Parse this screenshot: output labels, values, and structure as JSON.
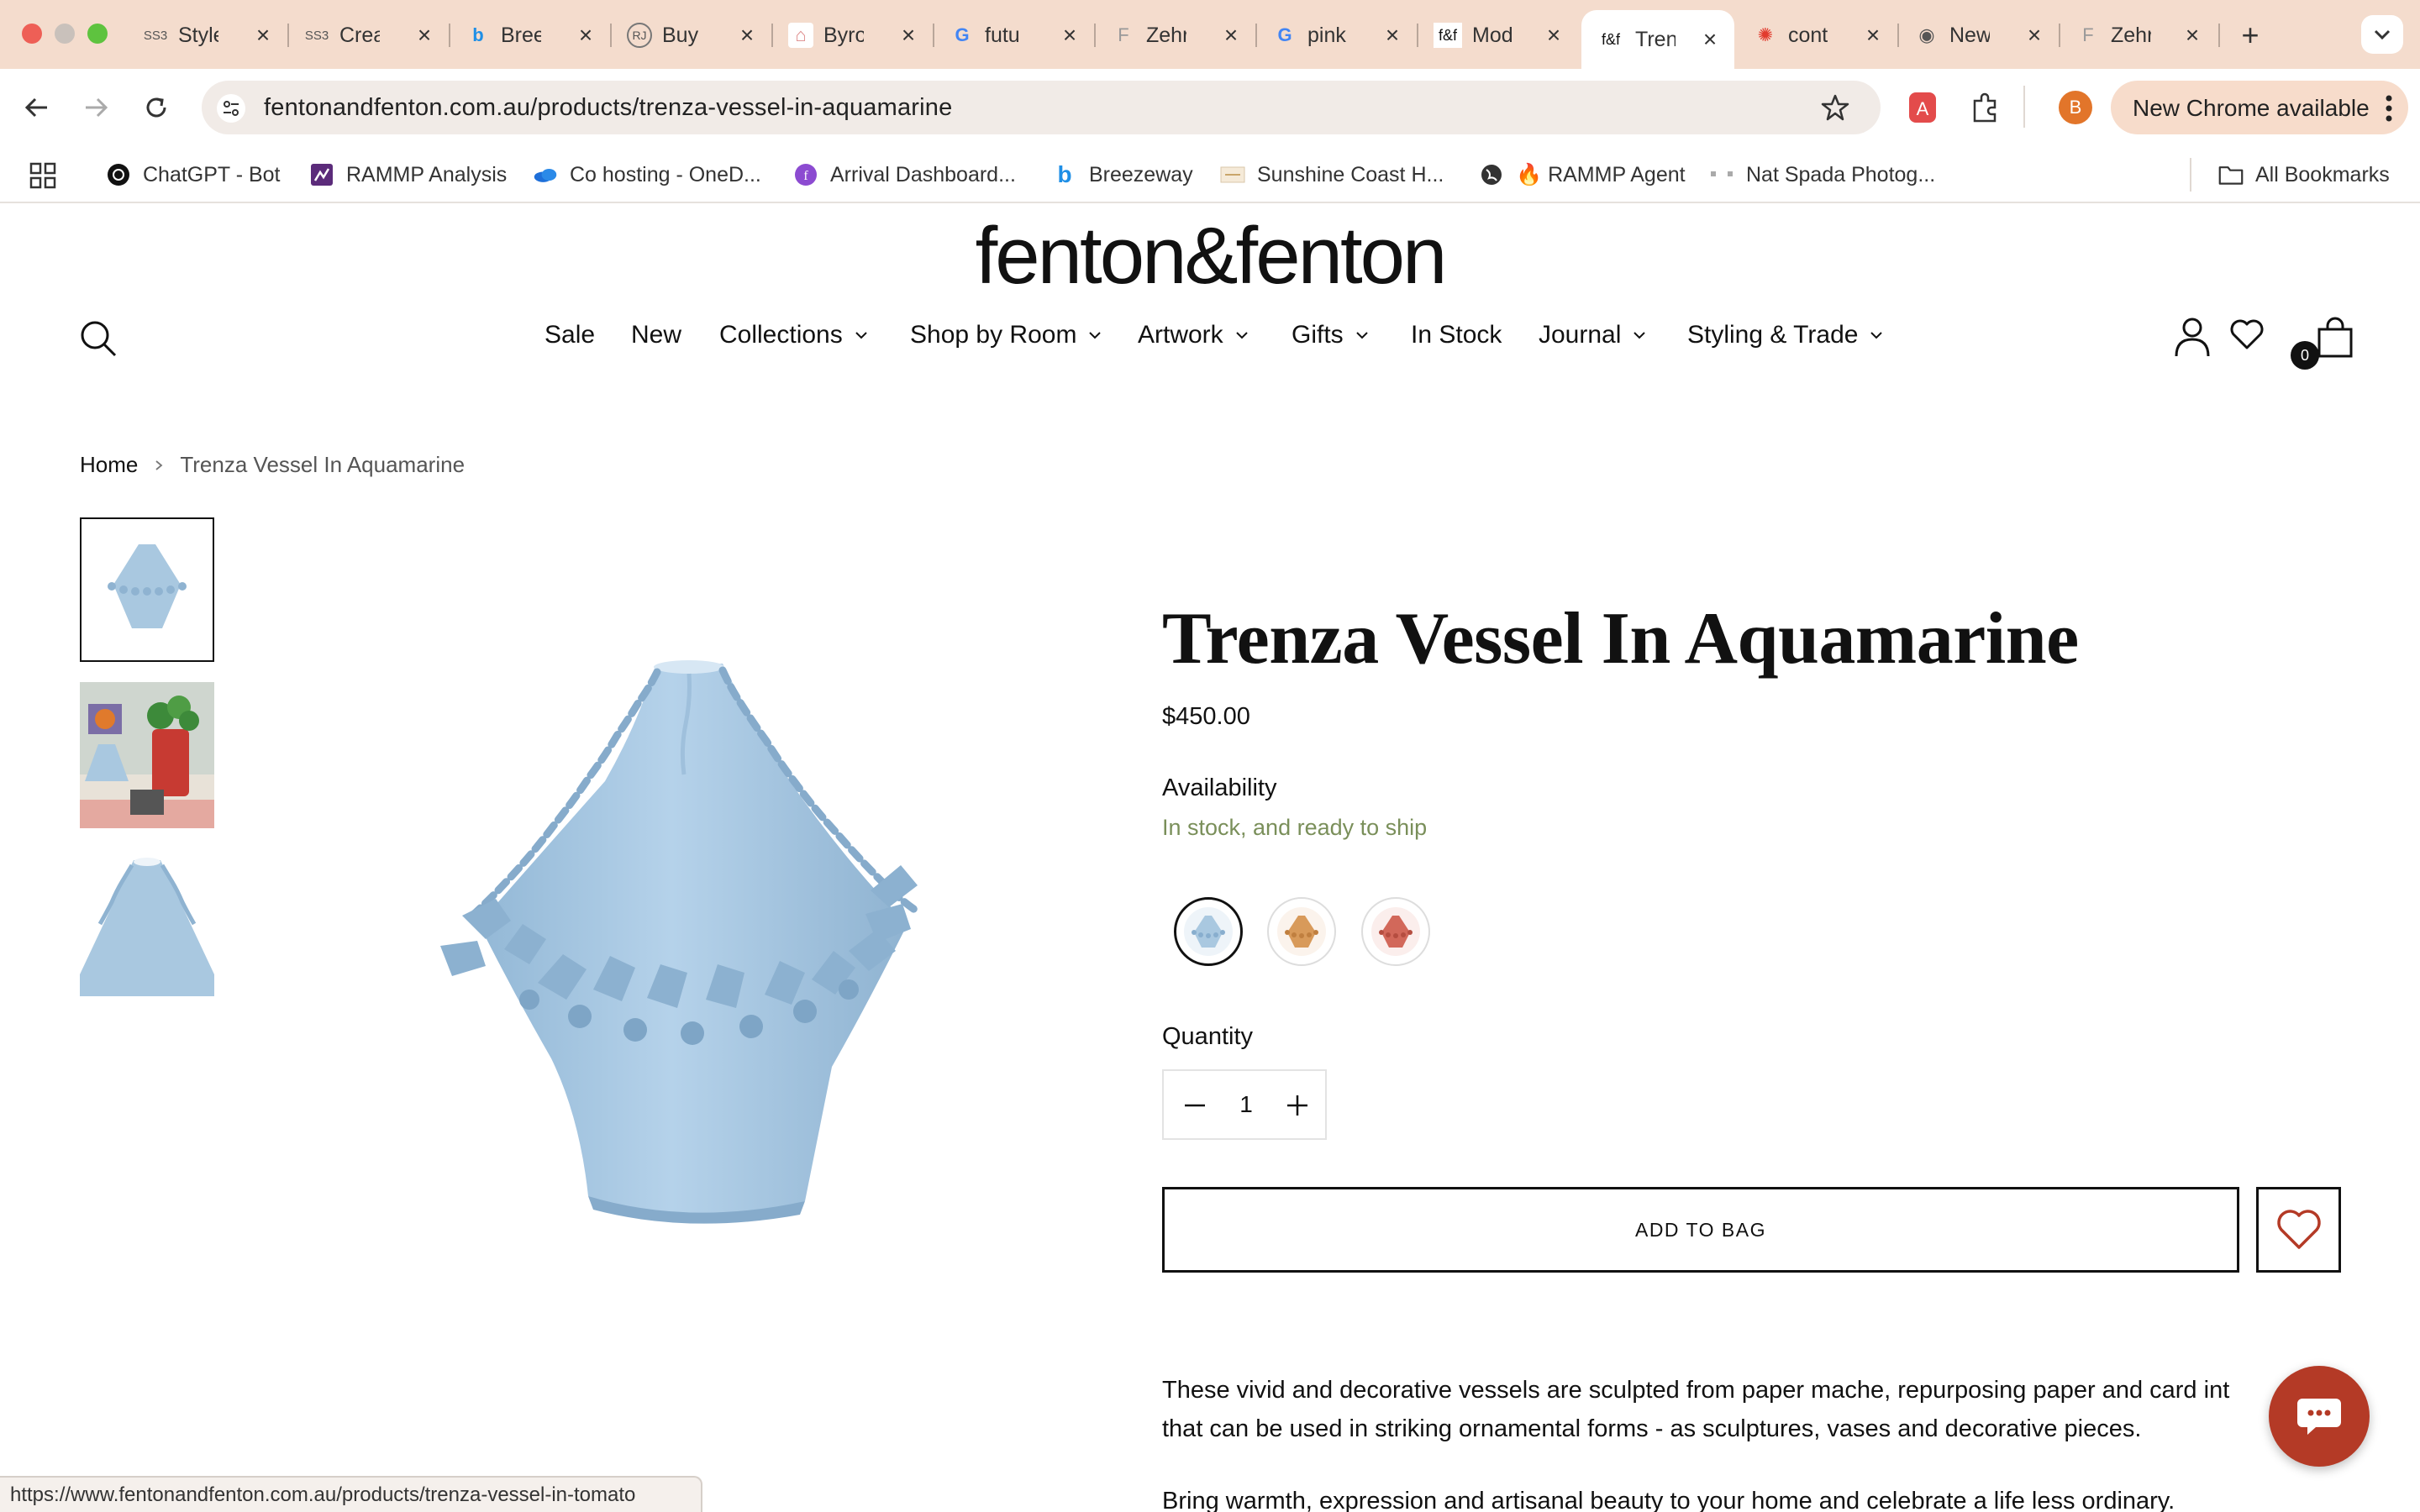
{
  "tabs": [
    {
      "icon": "SS3",
      "title": "Style"
    },
    {
      "icon": "SS3",
      "title": "Crea"
    },
    {
      "icon": "b",
      "title": "Bree"
    },
    {
      "icon": "RJ",
      "title": "Buy"
    },
    {
      "icon": "⌂",
      "title": "Byro"
    },
    {
      "icon": "G",
      "title": "futu"
    },
    {
      "icon": "F",
      "title": "Zehr"
    },
    {
      "icon": "G",
      "title": "pink"
    },
    {
      "icon": "f&f",
      "title": "Mod"
    },
    {
      "icon": "f&f",
      "title": "Tren",
      "active": true
    },
    {
      "icon": "✺",
      "title": "cont"
    },
    {
      "icon": "◉",
      "title": "New"
    },
    {
      "icon": "F",
      "title": "Zehr"
    }
  ],
  "browser": {
    "url": "fentonandfenton.com.au/products/trenza-vessel-in-aquamarine",
    "update_label": "New Chrome available",
    "profile_initial": "B"
  },
  "bookmarks": {
    "items": [
      {
        "label": "ChatGPT - Bot"
      },
      {
        "label": "RAMMP Analysis"
      },
      {
        "label": "Co hosting - OneD..."
      },
      {
        "label": "Arrival Dashboard..."
      },
      {
        "label": "Breezeway"
      },
      {
        "label": "Sunshine Coast H..."
      },
      {
        "label": "🔥 RAMMP Agent"
      },
      {
        "label": "Nat Spada Photog..."
      }
    ],
    "all_label": "All Bookmarks"
  },
  "site": {
    "logo": "fenton&fenton",
    "nav": [
      {
        "label": "Sale"
      },
      {
        "label": "New"
      },
      {
        "label": "Collections"
      },
      {
        "label": "Shop by Room"
      },
      {
        "label": "Artwork"
      },
      {
        "label": "Gifts"
      },
      {
        "label": "In Stock"
      },
      {
        "label": "Journal"
      },
      {
        "label": "Styling & Trade"
      }
    ],
    "cart_count": "0"
  },
  "breadcrumb": {
    "home": "Home",
    "current": "Trenza Vessel In Aquamarine"
  },
  "product": {
    "title": "Trenza Vessel In Aquamarine",
    "price": "$450.00",
    "availability_label": "Availability",
    "availability_status": "In stock, and ready to ship",
    "swatches": [
      {
        "name": "aquamarine",
        "color": "#a9c8e0",
        "selected": true
      },
      {
        "name": "ochre",
        "color": "#d89a5a"
      },
      {
        "name": "tomato",
        "color": "#d2685a"
      }
    ],
    "quantity_label": "Quantity",
    "quantity": "1",
    "add_to_bag_label": "ADD TO BAG",
    "description": [
      "These vivid and decorative vessels are sculpted from paper mache, repurposing paper and card int",
      "that can be used in striking ornamental forms - as sculptures, vases and decorative pieces.",
      "Bring warmth, expression and artisanal beauty to your home and celebrate a life less ordinary."
    ]
  },
  "status_url": "https://www.fentonandfenton.com.au/products/trenza-vessel-in-tomato",
  "colors": {
    "tabstrip": "#f4dccd",
    "accent_chat": "#b43a26",
    "vessel": "#a9c8e0",
    "availability": "#7a8f5a"
  }
}
